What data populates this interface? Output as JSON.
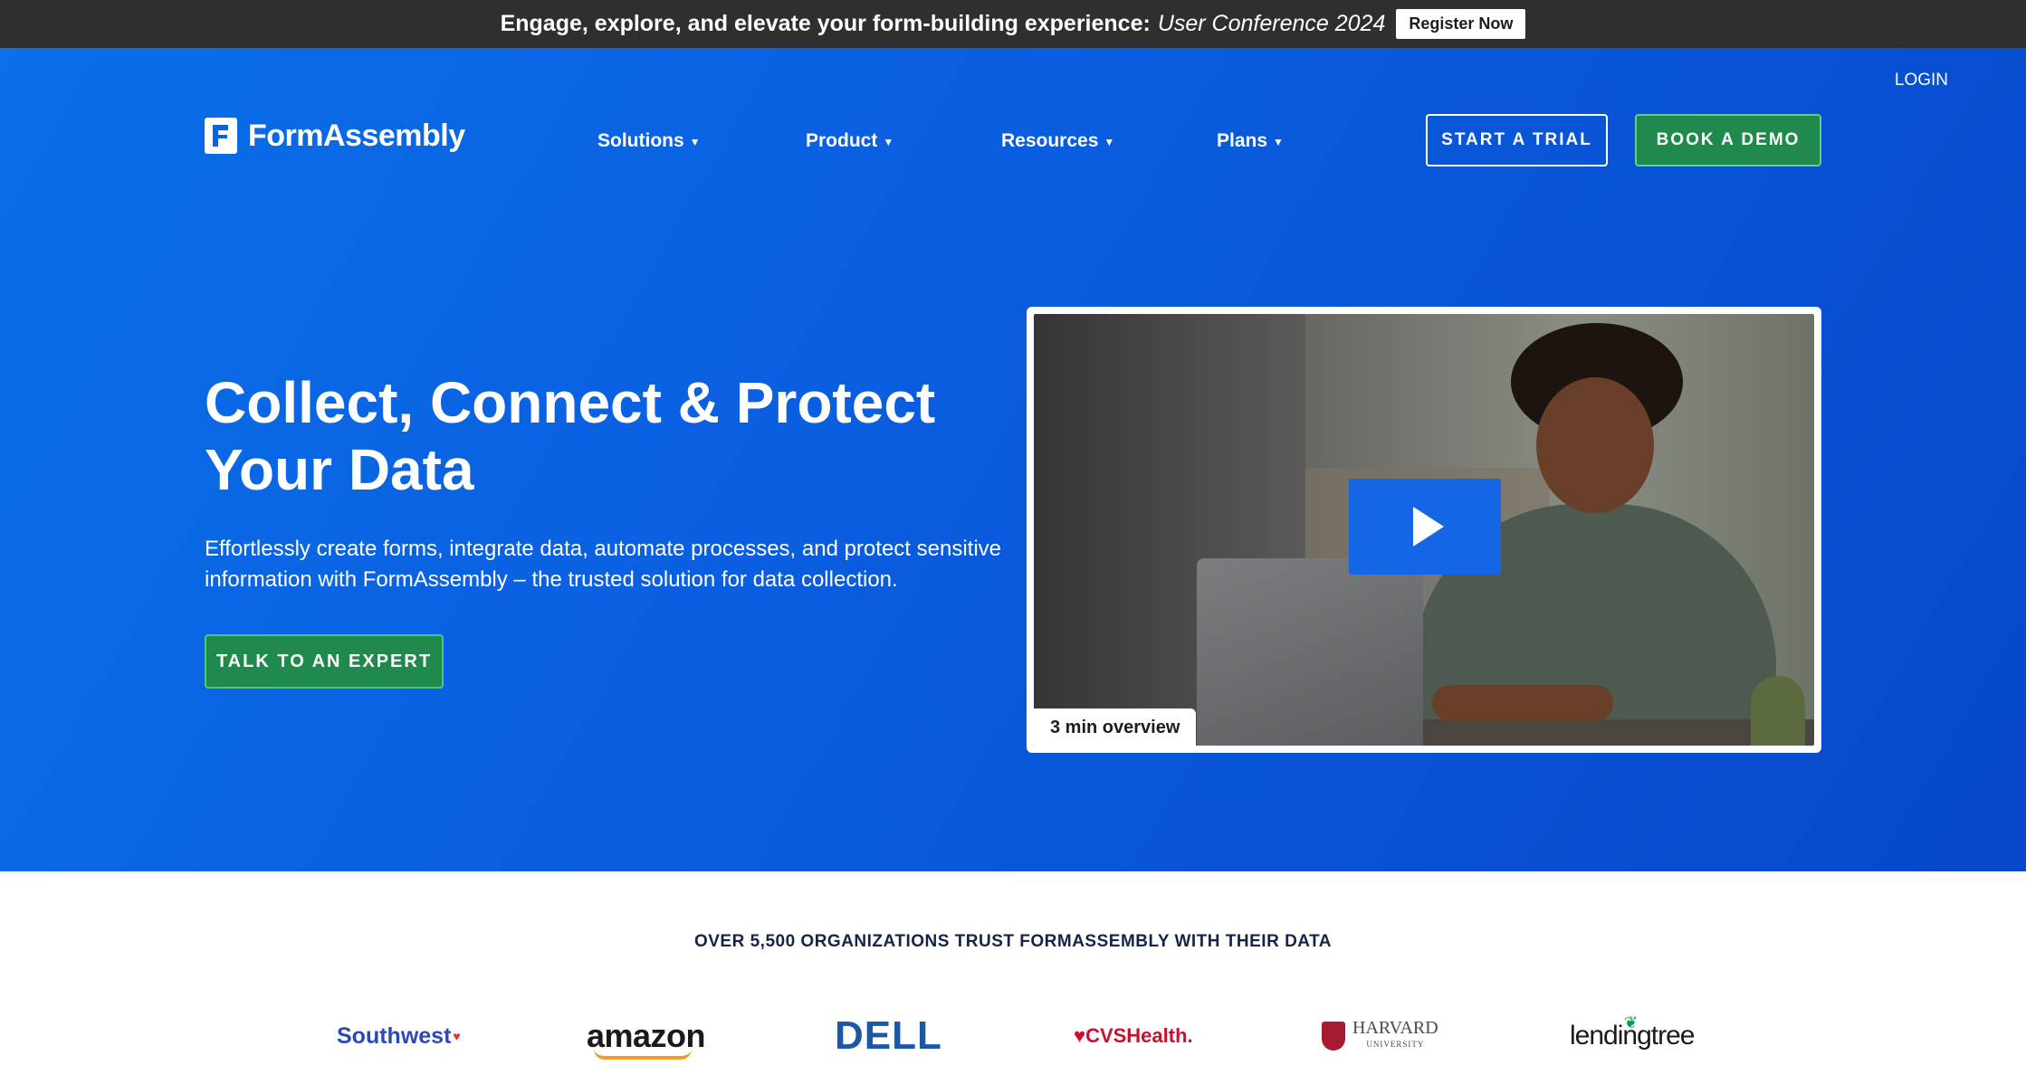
{
  "announcement": {
    "lead_text": "Engage, explore, and elevate your form-building experience:",
    "conference": "User Conference 2024",
    "register_label": "Register Now"
  },
  "header": {
    "login_label": "LOGIN",
    "logo_text": "FormAssembly",
    "nav": [
      {
        "label": "Solutions"
      },
      {
        "label": "Product"
      },
      {
        "label": "Resources"
      },
      {
        "label": "Plans"
      }
    ],
    "trial_label": "START A TRIAL",
    "demo_label": "BOOK A DEMO"
  },
  "hero": {
    "headline": "Collect, Connect & Protect Your Data",
    "subheadline": "Effortlessly create forms, integrate data, automate processes, and protect sensitive information with FormAssembly – the trusted solution for data collection.",
    "cta_label": "TALK TO AN EXPERT",
    "video_label": "3 min overview"
  },
  "trust": {
    "heading": "OVER 5,500 ORGANIZATIONS TRUST FORMASSEMBLY WITH THEIR DATA",
    "logos": [
      "Southwest",
      "amazon",
      "DELL",
      "CVSHealth.",
      "HARVARD",
      "lendingtree"
    ],
    "harvard_sub": "UNIVERSITY"
  },
  "colors": {
    "hero_blue": "#0a62e3",
    "cta_green": "#1f8a4c",
    "topbar": "#2f2f2f"
  }
}
